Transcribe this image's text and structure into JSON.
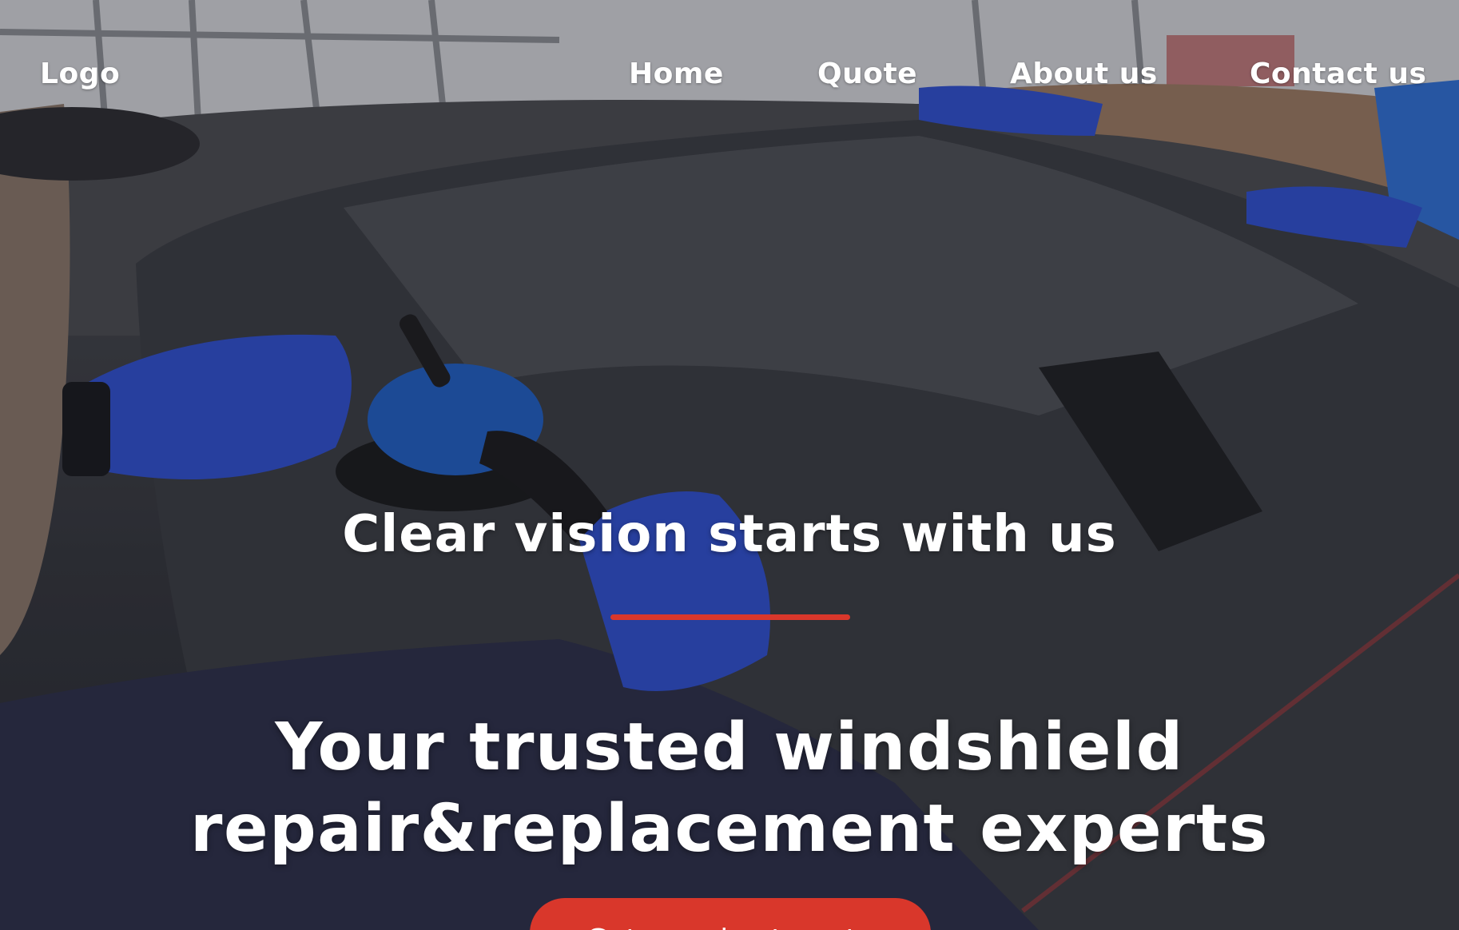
{
  "nav": {
    "logo": "Logo",
    "links": [
      "Home",
      "Quote",
      "About us",
      "Contact us"
    ]
  },
  "hero": {
    "tagline": "Clear vision starts with us",
    "headline_line1": "Your trusted windshield",
    "headline_line2": "repair&replacement experts",
    "cta_label": "Get your best quote"
  },
  "colors": {
    "accent": "#d9372b",
    "text": "#ffffff",
    "glove_blue": "#2f4fd0"
  }
}
